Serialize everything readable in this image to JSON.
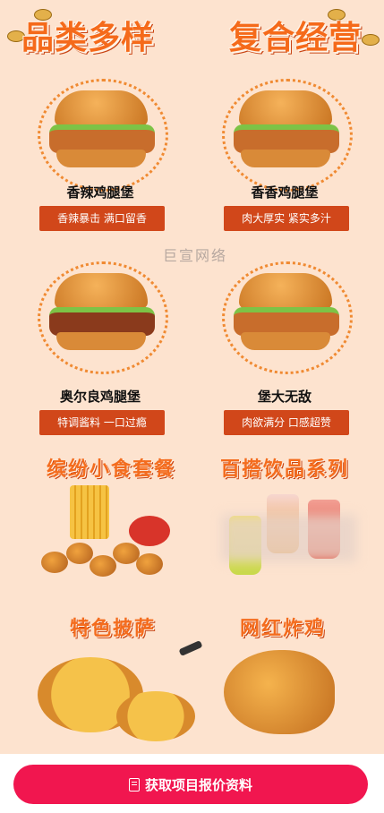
{
  "banner": {
    "left": "品类多样",
    "right": "复合经营"
  },
  "watermark": "巨宣网络",
  "burgers": [
    {
      "name": "香辣鸡腿堡",
      "tag": "香辣暴击 满口留香"
    },
    {
      "name": "香香鸡腿堡",
      "tag": "肉大厚实 紧实多汁"
    },
    {
      "name": "奥尔良鸡腿堡",
      "tag": "特调酱料 一口过瘾"
    },
    {
      "name": "堡大无敌",
      "tag": "肉欲满分 口感超赞"
    }
  ],
  "sections": [
    {
      "title": "缤纷小食套餐"
    },
    {
      "title": "百搭饮品系列"
    },
    {
      "title": "特色披萨"
    },
    {
      "title": "网红炸鸡"
    }
  ],
  "cta": {
    "label": "获取项目报价资料",
    "icon": "document-icon"
  }
}
